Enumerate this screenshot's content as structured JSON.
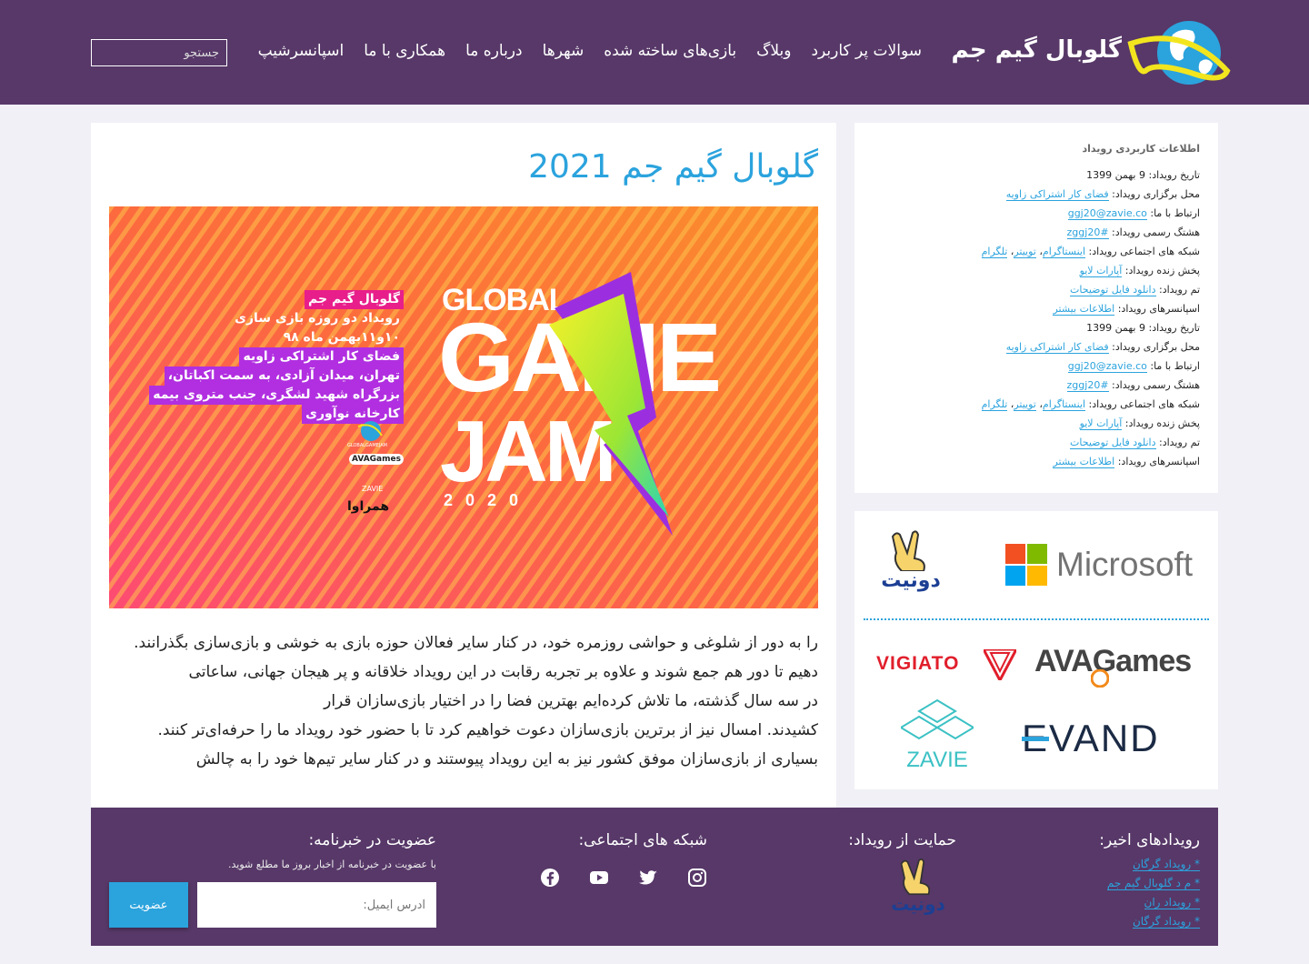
{
  "header": {
    "site_name": "گلوبال گیم جم",
    "nav": [
      "سوالات پر کاربرد",
      "وبلاگ",
      "بازی‌های ساخته شده",
      "شهرها",
      "درباره ما",
      "همکاری با ما",
      "اسپانسرشیپ"
    ],
    "search_placeholder": "جستجو",
    "colors": {
      "header_bg": "#573868",
      "accent": "#2ba3dd"
    }
  },
  "main": {
    "title": "گلوبال گیم جم 2021",
    "banner": {
      "logo_global": "GLOBAL",
      "logo_game": "GAME",
      "logo_jam": "JAM",
      "logo_year": "2020",
      "event_lines": [
        "گلوبال گیم جم",
        "رویداد دو روزه بازی سازی",
        "۱۰و۱۱بهمن ماه ۹۸",
        "فضای کار اشتراکی زاویه",
        "تهران، میدان آزادی، به سمت اکباتان،",
        "بزرگراه شهید لشگری، جنب متروی بیمه",
        "کارخانه نوآوری"
      ],
      "mini_logos": [
        "GLOBALGAMEJAM",
        "AVAGames",
        "ZAVIE",
        "همراوا"
      ]
    },
    "body_lines": [
      "را به دور از شلوغی و حواشی روزمره خود، در کنار سایر فعالان حوزه بازی به خوشی و بازی‌سازی بگذرانند.",
      "دهیم تا دور هم جمع شوند و علاوه بر تجربه رقابت در این رویداد خلاقانه و پر هیجان جهانی، ساعاتی",
      "در سه سال گذشته، ما تلاش کرده‌ایم بهترین فضا را در اختیار بازی‌سازان قرار",
      "کشیدند. امسال نیز از برترین بازی‌سازان دعوت خواهیم کرد تا با حضور خود رویداد ما را حرفه‌ای‌تر کنند.",
      "بسیاری از بازی‌سازان موفق کشور نیز به این رویداد پیوستند و در کنار سایر تیم‌ها خود را به چالش"
    ]
  },
  "sidebar": {
    "info_title": "اطلاعات کاربردی رویداد",
    "labels": {
      "date": "تاریخ رویداد:",
      "venue": "محل برگزاری رویداد:",
      "contact": "ارتباط با ما:",
      "hashtag": "هشتگ رسمی رویداد:",
      "social": "شبکه های اجتماعی رویداد:",
      "live": "پخش زنده رویداد:",
      "theme": "تم رویداد:",
      "sponsors": "اسپانسرهای رویداد:"
    },
    "values": {
      "date": "9 بهمن 1399",
      "venue": "فضای کار اشتراکی زاویه",
      "contact": "ggj20@zavie.co",
      "hashtag": "#zggj20",
      "instagram": "اینستاگرام",
      "twitter": "توییتر",
      "telegram": "تلگرام",
      "comma": "، ",
      "live": "آپارات لایو",
      "theme": "دانلود فایل توضیحات",
      "sponsors": "اطلاعات بیشتر"
    },
    "sponsor_logos": {
      "microsoft": "Microsoft",
      "donate": "دونیت",
      "avagames": "AVAGames",
      "vigiato": "VIGIATO",
      "evand": "EVAND",
      "zavie": "ZAVIE"
    }
  },
  "footer": {
    "recent_title": "رویدادهای اخیر:",
    "recent_links": [
      "* رویداد گرگان",
      "* م د گلوبال گیم جم",
      "* رویداد ران",
      "* رویداد گرگان"
    ],
    "support_title": "حمایت از رویداد:",
    "support_logo": "دونیت",
    "social_title": "شبکه های اجتماعی:",
    "newsletter_title": "عضویت در خبرنامه:",
    "newsletter_desc": "با عضویت در خبرنامه از اخبار بروز ما مطلع شوید.",
    "email_placeholder": "آدرس ایمیل:",
    "submit_label": "عضویت"
  }
}
